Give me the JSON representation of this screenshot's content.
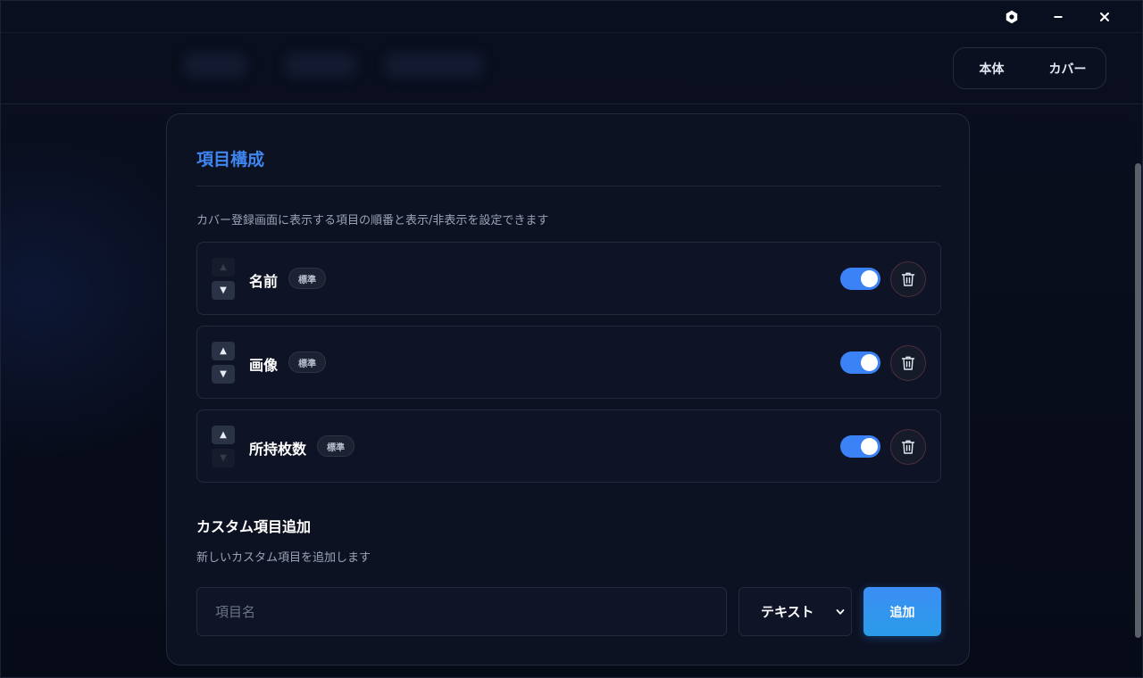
{
  "window": {
    "buttons": [
      {
        "name": "settings",
        "icon": "gear-icon"
      },
      {
        "name": "minimize",
        "icon": "minimize-icon"
      },
      {
        "name": "close",
        "icon": "close-icon"
      }
    ]
  },
  "mode_switch": {
    "main_label": "本体",
    "cover_label": "カバー"
  },
  "card": {
    "title": "項目構成",
    "description": "カバー登録画面に表示する項目の順番と表示/非表示を設定できます",
    "fields": [
      {
        "name": "名前",
        "badge": "標準",
        "visible": true,
        "up_enabled": false,
        "down_enabled": true
      },
      {
        "name": "画像",
        "badge": "標準",
        "visible": true,
        "up_enabled": true,
        "down_enabled": true
      },
      {
        "name": "所持枚数",
        "badge": "標準",
        "visible": true,
        "up_enabled": true,
        "down_enabled": false
      }
    ],
    "arrows": {
      "up": "▲",
      "down": "▼"
    }
  },
  "custom": {
    "title": "カスタム項目追加",
    "description": "新しいカスタム項目を追加します",
    "input_placeholder": "項目名",
    "input_value": "",
    "type_selected": "テキスト",
    "add_label": "追加"
  },
  "colors": {
    "accent": "#3b82f6",
    "title_blue": "#3f86f0",
    "background": "#070b18",
    "card": "#0d1222"
  }
}
